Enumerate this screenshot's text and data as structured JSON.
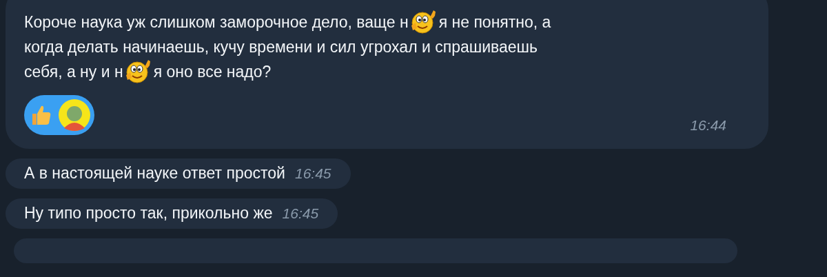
{
  "messages": [
    {
      "lines": [
        [
          {
            "kind": "text",
            "text": "Короче наука уж слишком заморочное дело, ваще н"
          },
          {
            "kind": "emoji"
          },
          {
            "kind": "text",
            "text": "я не понятно, а"
          }
        ],
        [
          {
            "kind": "text",
            "text": "когда делать начинаешь, кучу времени и сил угрохал и спрашиваешь"
          }
        ],
        [
          {
            "kind": "text",
            "text": "себя, а ну и н"
          },
          {
            "kind": "emoji"
          },
          {
            "kind": "text",
            "text": "я оно все надо?"
          }
        ]
      ],
      "reactions": {
        "selected": true,
        "items": [
          {
            "kind": "thumbs"
          },
          {
            "kind": "avatar"
          }
        ]
      },
      "time": "16:44"
    },
    {
      "lines": [
        [
          {
            "kind": "text",
            "text": "А в настоящей науке ответ простой"
          }
        ]
      ],
      "time": "16:45"
    },
    {
      "lines": [
        [
          {
            "kind": "text",
            "text": "Ну типо просто так, прикольно же"
          }
        ]
      ],
      "time": "16:45"
    },
    {
      "kind": "cut"
    }
  ]
}
